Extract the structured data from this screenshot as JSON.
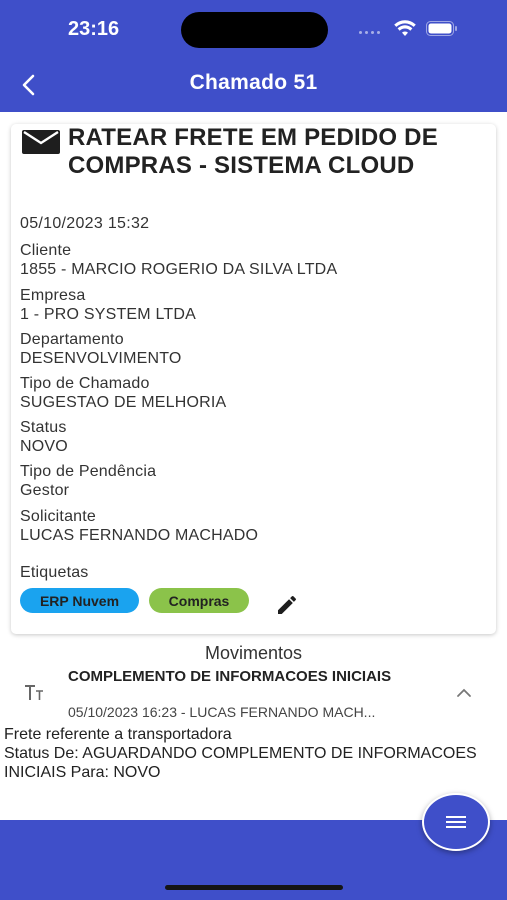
{
  "status_bar": {
    "time": "23:16"
  },
  "header": {
    "title": "Chamado 51"
  },
  "ticket": {
    "title": "RATEAR FRETE EM PEDIDO DE COMPRAS -  SISTEMA CLOUD",
    "date": "05/10/2023 15:32",
    "fields": [
      {
        "label": "Cliente",
        "value": "1855 - MARCIO ROGERIO DA SILVA LTDA"
      },
      {
        "label": "Empresa",
        "value": "1 - PRO SYSTEM LTDA"
      },
      {
        "label": "Departamento",
        "value": "DESENVOLVIMENTO"
      },
      {
        "label": "Tipo de Chamado",
        "value": "SUGESTAO DE MELHORIA"
      },
      {
        "label": "Status",
        "value": "NOVO"
      },
      {
        "label": "Tipo de Pendência",
        "value": "Gestor"
      },
      {
        "label": "Solicitante",
        "value": "LUCAS FERNANDO MACHADO"
      }
    ],
    "tags_label": "Etiquetas",
    "tags": [
      {
        "label": "ERP Nuvem",
        "color": "#1aa3ef"
      },
      {
        "label": "Compras",
        "color": "#8bc34a"
      }
    ]
  },
  "movements": {
    "title": "Movimentos",
    "items": [
      {
        "title": "COMPLEMENTO DE INFORMACOES INICIAIS",
        "subtitle": "05/10/2023 16:23 - LUCAS FERNANDO MACH...",
        "body_line1": "Frete referente a transportadora",
        "body_line2": "Status De: AGUARDANDO COMPLEMENTO DE INFORMACOES INICIAIS Para: NOVO"
      }
    ]
  },
  "colors": {
    "primary": "#3f4fc9"
  },
  "icons": [
    "back-arrow-icon",
    "mail-icon",
    "edit-pencil-icon",
    "text-type-icon",
    "chevron-up-icon",
    "menu-icon",
    "wifi-icon",
    "battery-icon"
  ]
}
